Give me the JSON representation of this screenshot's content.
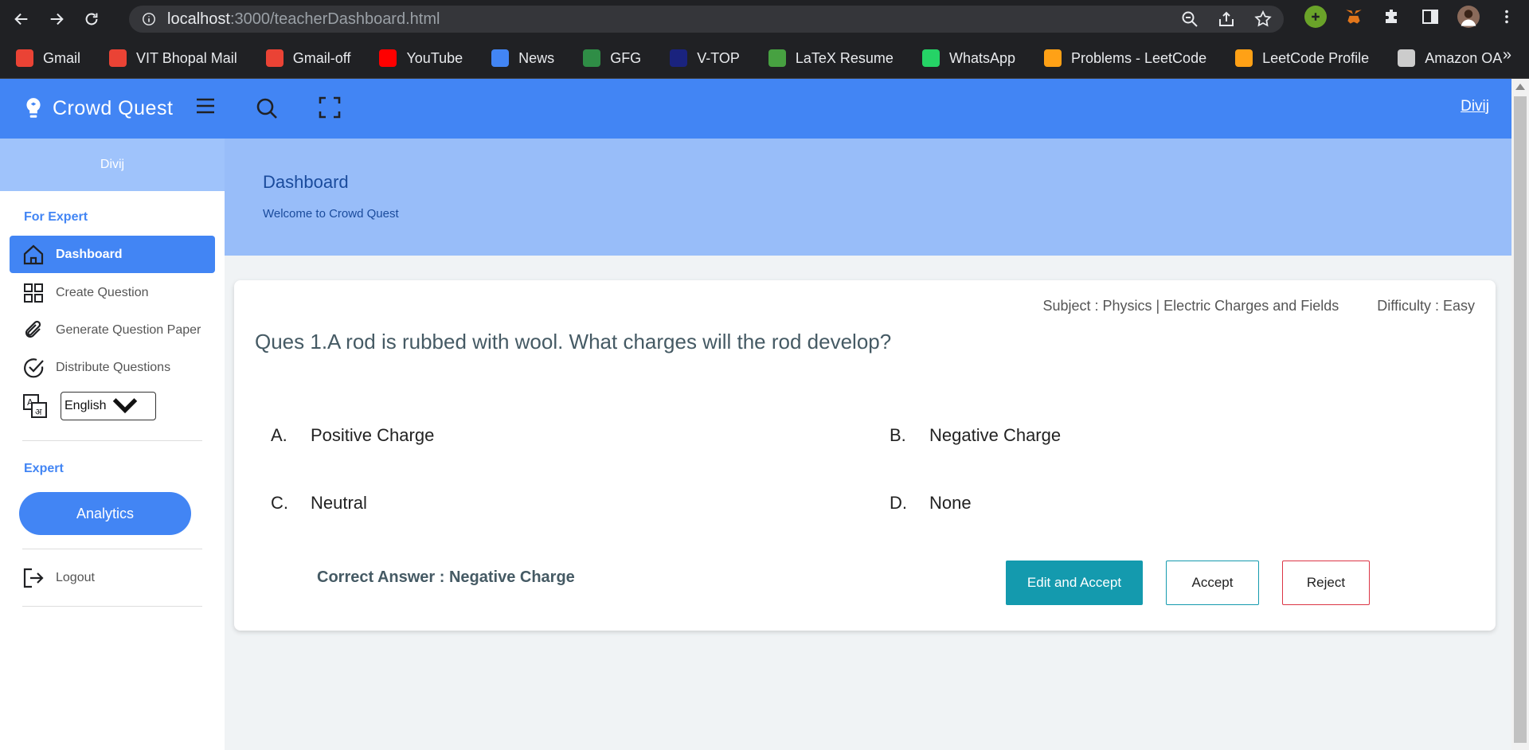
{
  "browser": {
    "url_host": "localhost",
    "url_path": ":3000/teacherDashboard.html",
    "bookmarks": [
      {
        "label": "Gmail",
        "icon": "gmail-icon",
        "color": "#ea4335"
      },
      {
        "label": "VIT Bhopal Mail",
        "icon": "gmail-icon",
        "color": "#ea4335"
      },
      {
        "label": "Gmail-off",
        "icon": "gmail-icon",
        "color": "#ea4335"
      },
      {
        "label": "YouTube",
        "icon": "youtube-icon",
        "color": "#ff0000"
      },
      {
        "label": "News",
        "icon": "google-news-icon",
        "color": "#4285f4"
      },
      {
        "label": "GFG",
        "icon": "gfg-icon",
        "color": "#2f8d46"
      },
      {
        "label": "V-TOP",
        "icon": "vtop-icon",
        "color": "#1a237e"
      },
      {
        "label": "LaTeX Resume",
        "icon": "overleaf-icon",
        "color": "#47a141"
      },
      {
        "label": "WhatsApp",
        "icon": "whatsapp-icon",
        "color": "#25d366"
      },
      {
        "label": "Problems - LeetCode",
        "icon": "leetcode-icon",
        "color": "#ffa116"
      },
      {
        "label": "LeetCode Profile",
        "icon": "leetcode-icon",
        "color": "#ffa116"
      },
      {
        "label": "Amazon OA",
        "icon": "globe-icon",
        "color": "#cccccc"
      }
    ],
    "more_label": "»"
  },
  "app": {
    "brand": "Crowd Quest",
    "user": "Divij"
  },
  "sidebar": {
    "user": "Divij",
    "section1": "For Expert",
    "items": [
      {
        "label": "Dashboard",
        "icon": "home-icon"
      },
      {
        "label": "Create Question",
        "icon": "grid-icon"
      },
      {
        "label": "Generate Question Paper",
        "icon": "paperclip-icon"
      },
      {
        "label": "Distribute Questions",
        "icon": "check-circle-icon"
      }
    ],
    "language": "English",
    "section2": "Expert",
    "analytics": "Analytics",
    "logout": "Logout"
  },
  "banner": {
    "title": "Dashboard",
    "subtitle": "Welcome to Crowd Quest"
  },
  "question": {
    "subject": "Subject : Physics | Electric Charges and Fields",
    "difficulty": "Difficulty : Easy",
    "text": "Ques 1.A rod is rubbed with wool. What charges will the rod develop?",
    "options": [
      {
        "letter": "A.",
        "text": "Positive Charge"
      },
      {
        "letter": "B.",
        "text": "Negative Charge"
      },
      {
        "letter": "C.",
        "text": "Neutral"
      },
      {
        "letter": "D.",
        "text": "None"
      }
    ],
    "correct": "Correct Answer : Negative Charge",
    "buttons": {
      "edit": "Edit and Accept",
      "accept": "Accept",
      "reject": "Reject"
    }
  }
}
